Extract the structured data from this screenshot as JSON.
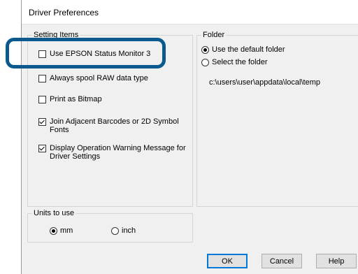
{
  "dialog": {
    "title": "Driver Preferences"
  },
  "setting_items": {
    "legend": "Setting Items",
    "items": [
      {
        "label": "Use EPSON Status Monitor 3",
        "checked": false
      },
      {
        "label": "Always spool RAW data type",
        "checked": false
      },
      {
        "label": "Print as Bitmap",
        "checked": false
      },
      {
        "label": "Join Adjacent Barcodes or 2D Symbol Fonts",
        "checked": true
      },
      {
        "label": "Display Operation Warning Message for Driver Settings",
        "checked": true
      }
    ]
  },
  "folder": {
    "legend": "Folder",
    "options": [
      {
        "label": "Use the default folder",
        "selected": true
      },
      {
        "label": "Select the folder",
        "selected": false
      }
    ],
    "path": "c:\\users\\user\\appdata\\local\\temp"
  },
  "units": {
    "legend": "Units to use",
    "options": [
      {
        "label": "mm",
        "selected": true
      },
      {
        "label": "inch",
        "selected": false
      }
    ]
  },
  "buttons": {
    "ok": "OK",
    "cancel": "Cancel",
    "help": "Help"
  },
  "colors": {
    "highlight": "#0b5a8f",
    "dialog_bg": "#f0f0f0",
    "default_button_border": "#0078d7"
  }
}
